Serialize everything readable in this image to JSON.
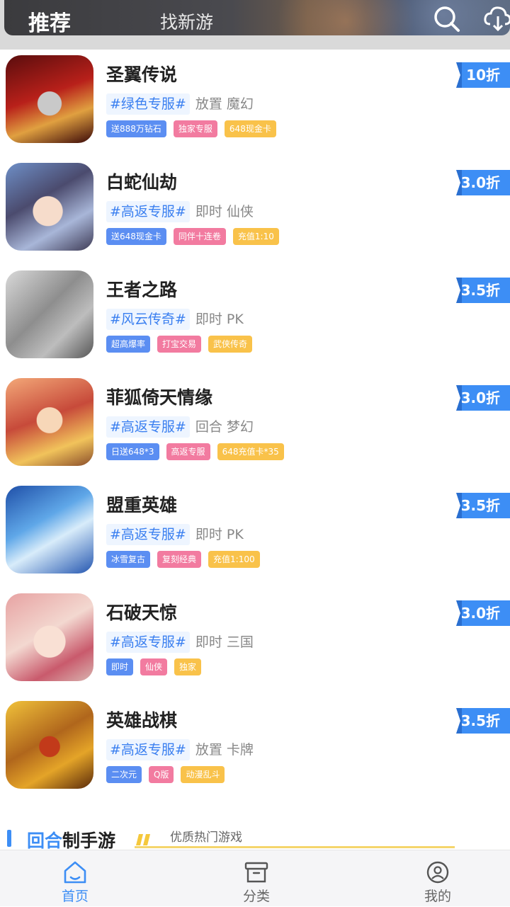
{
  "header": {
    "tab_active": "推荐",
    "tab_inactive": "找新游",
    "icons": [
      "search-icon",
      "download-icon"
    ]
  },
  "games": [
    {
      "name": "圣翼传说",
      "hash": "#绿色专服#",
      "cats": "放置 魔幻",
      "discount": "10折",
      "chips": [
        {
          "text": "送888万钻石",
          "color": "blue"
        },
        {
          "text": "独家专服",
          "color": "pink"
        },
        {
          "text": "648现金卡",
          "color": "yellow"
        }
      ]
    },
    {
      "name": "白蛇仙劫",
      "hash": "#高返专服#",
      "cats": "即时 仙侠",
      "discount": "3.0折",
      "chips": [
        {
          "text": "送648现金卡",
          "color": "blue"
        },
        {
          "text": "同伴十连卷",
          "color": "pink"
        },
        {
          "text": "充值1:10",
          "color": "yellow"
        }
      ]
    },
    {
      "name": "王者之路",
      "hash": "#风云传奇#",
      "cats": "即时 PK",
      "discount": "3.5折",
      "chips": [
        {
          "text": "超高爆率",
          "color": "blue"
        },
        {
          "text": "打宝交易",
          "color": "pink"
        },
        {
          "text": "武侠传奇",
          "color": "yellow"
        }
      ]
    },
    {
      "name": "菲狐倚天情缘",
      "hash": "#高返专服#",
      "cats": "回合 梦幻",
      "discount": "3.0折",
      "chips": [
        {
          "text": "日送648*3",
          "color": "blue"
        },
        {
          "text": "高返专服",
          "color": "pink"
        },
        {
          "text": "648充值卡*35",
          "color": "yellow"
        }
      ]
    },
    {
      "name": "盟重英雄",
      "hash": "#高返专服#",
      "cats": "即时 PK",
      "discount": "3.5折",
      "chips": [
        {
          "text": "冰雪复古",
          "color": "blue"
        },
        {
          "text": "复刻经典",
          "color": "pink"
        },
        {
          "text": "充值1:100",
          "color": "yellow"
        }
      ]
    },
    {
      "name": "石破天惊",
      "hash": "#高返专服#",
      "cats": "即时 三国",
      "discount": "3.0折",
      "chips": [
        {
          "text": "即时",
          "color": "blue"
        },
        {
          "text": "仙侠",
          "color": "pink"
        },
        {
          "text": "独家",
          "color": "yellow"
        }
      ]
    },
    {
      "name": "英雄战棋",
      "hash": "#高返专服#",
      "cats": "放置 卡牌",
      "discount": "3.5折",
      "chips": [
        {
          "text": "二次元",
          "color": "blue"
        },
        {
          "text": "Q版",
          "color": "pink"
        },
        {
          "text": "动漫乱斗",
          "color": "yellow"
        }
      ]
    }
  ],
  "section": {
    "title_blue": "回合",
    "title_dark": "制手游",
    "subtitle": "优质热门游戏"
  },
  "tabbar": [
    {
      "label": "首页",
      "icon": "home-icon",
      "active": true
    },
    {
      "label": "分类",
      "icon": "category-box-icon",
      "active": false
    },
    {
      "label": "我的",
      "icon": "profile-icon",
      "active": false
    }
  ],
  "colors": {
    "accent": "#3d8ef5",
    "chip_blue": "#5b8ef2",
    "chip_pink": "#f27ba0",
    "chip_yellow": "#f9c24a",
    "inactive": "#666666"
  }
}
